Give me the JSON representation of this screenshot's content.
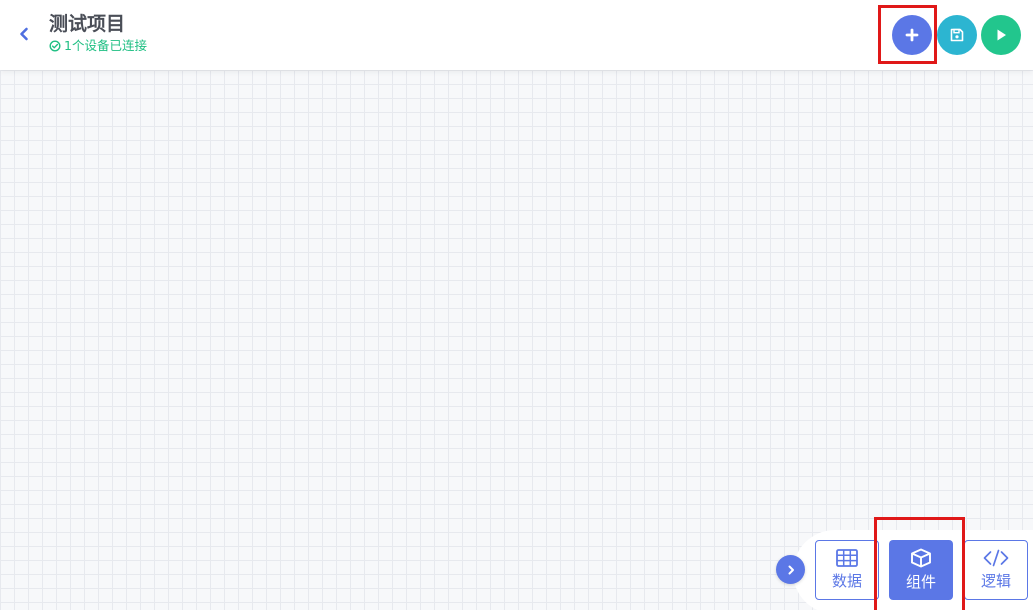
{
  "header": {
    "title": "测试项目",
    "status_text": "1个设备已连接"
  },
  "icons": {
    "back": "chevron-left-icon",
    "status": "check-circle-icon",
    "add": "plus-icon",
    "save": "floppy-disk-icon",
    "run": "play-icon",
    "toggle": "chevron-right-icon",
    "data": "table-icon",
    "component": "cube-icon",
    "logic": "code-icon"
  },
  "bottom_dock": {
    "tabs": [
      {
        "label": "数据",
        "active": false
      },
      {
        "label": "组件",
        "active": true
      },
      {
        "label": "逻辑",
        "active": false
      }
    ]
  },
  "colors": {
    "accent_blue": "#5b77e6",
    "save_teal": "#2cb5d1",
    "run_green": "#22c68d",
    "status_green": "#1fbf83",
    "highlight_red": "#e01818"
  }
}
